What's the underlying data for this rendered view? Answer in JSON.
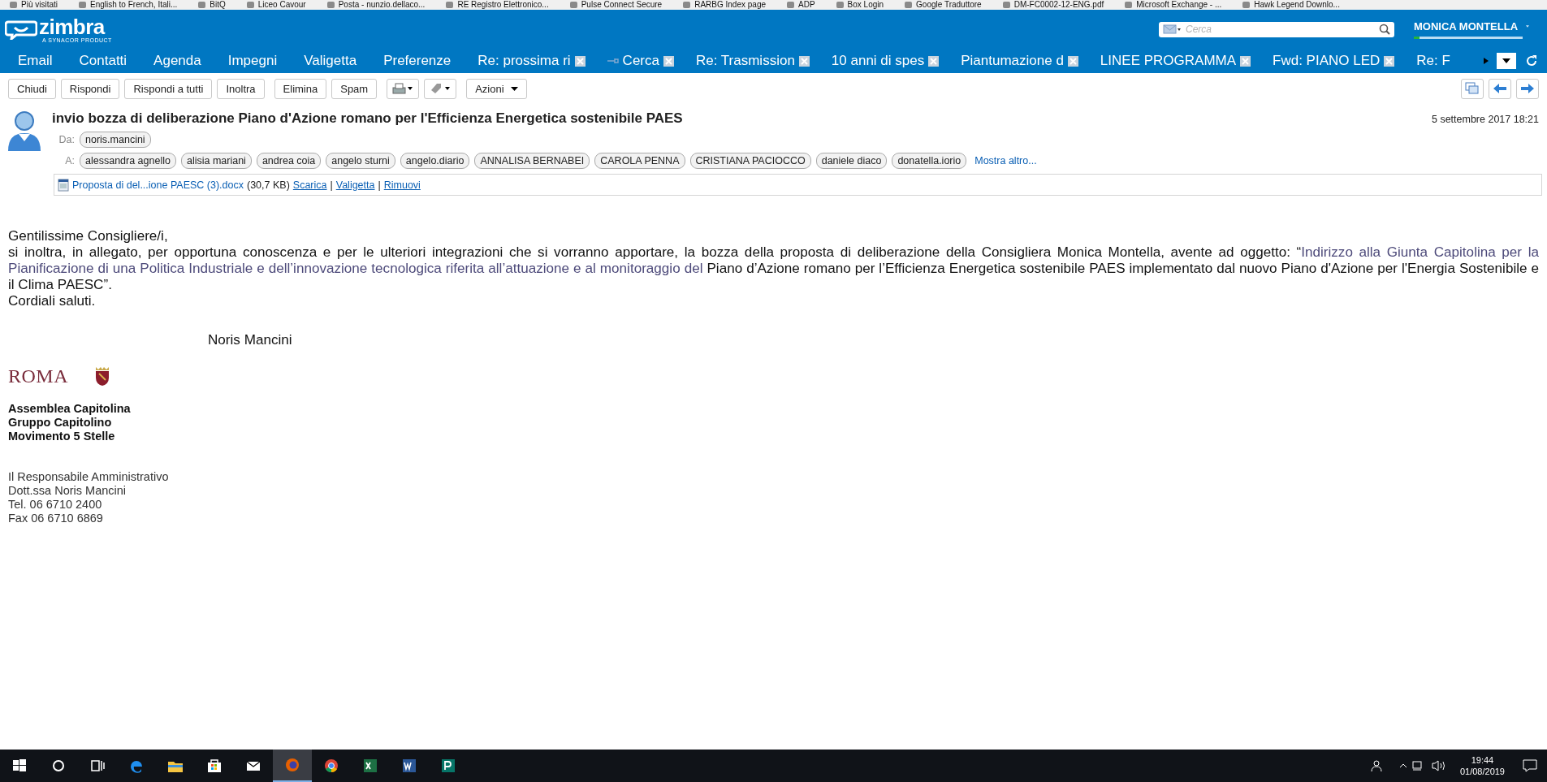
{
  "bookmarks": [
    {
      "label": "Più visitati"
    },
    {
      "label": "English to French, Itali..."
    },
    {
      "label": "BitQ"
    },
    {
      "label": "Liceo Cavour"
    },
    {
      "label": "Posta - nunzio.dellaco..."
    },
    {
      "label": "RE Registro Elettronico..."
    },
    {
      "label": "Pulse Connect Secure"
    },
    {
      "label": "RARBG Index page"
    },
    {
      "label": "ADP"
    },
    {
      "label": "Box Login"
    },
    {
      "label": "Google Traduttore"
    },
    {
      "label": "DM-FC0002-12-ENG.pdf"
    },
    {
      "label": "Microsoft Exchange - ..."
    },
    {
      "label": "Hawk Legend Downlo..."
    }
  ],
  "header": {
    "logo": "zimbra",
    "logo_tagline": "A SYNACOR PRODUCT",
    "search": {
      "placeholder": "Cerca"
    },
    "user": "MONICA MONTELLA",
    "quota": {
      "level": 0.05
    }
  },
  "app_tabs": [
    {
      "label": "Email"
    },
    {
      "label": "Contatti"
    },
    {
      "label": "Agenda"
    },
    {
      "label": "Impegni"
    },
    {
      "label": "Valigetta"
    },
    {
      "label": "Preferenze"
    }
  ],
  "open_tabs": [
    {
      "label": "Re: prossima ri",
      "kind": "mail"
    },
    {
      "label": "Cerca",
      "kind": "search"
    },
    {
      "label": "Re: Trasmission",
      "kind": "mail"
    },
    {
      "label": "10 anni di spes",
      "kind": "mail"
    },
    {
      "label": "Piantumazione d",
      "kind": "mail"
    },
    {
      "label": "LINEE PROGRAMMA",
      "kind": "mail"
    },
    {
      "label": "Fwd: PIANO LED",
      "kind": "mail"
    },
    {
      "label": "Re: F",
      "kind": "cut"
    }
  ],
  "toolbar": [
    {
      "label": "Chiudi",
      "kind": "text"
    },
    {
      "label": "Rispondi",
      "kind": "text"
    },
    {
      "label": "Rispondi a tutti",
      "kind": "text"
    },
    {
      "label": "Inoltra",
      "kind": "text"
    },
    {
      "label": "Elimina",
      "kind": "text"
    },
    {
      "label": "Spam",
      "kind": "text"
    },
    {
      "kind": "print"
    },
    {
      "kind": "tag"
    },
    {
      "label": "Azioni",
      "kind": "menu"
    }
  ],
  "message": {
    "subject": "invio bozza di deliberazione Piano d'Azione romano per l'Efficienza Energetica sostenibile PAES",
    "date": "5 settembre 2017 18:21",
    "from_label": "Da:",
    "from": "noris.mancini",
    "to_label": "A:",
    "to": [
      "alessandra agnello",
      "alisia mariani",
      "andrea coia",
      "angelo sturni",
      "angelo.diario",
      "ANNALISA BERNABEI",
      "CAROLA PENNA",
      "CRISTIANA PACIOCCO",
      "daniele diaco",
      "donatella.iorio"
    ],
    "more": "Mostra altro...",
    "attachment": {
      "name": "Proposta di del...ione PAESC (3).docx",
      "size": "(30,7 KB)",
      "actions": [
        "Scarica",
        "Valigetta",
        "Rimuovi"
      ],
      "separator": "|"
    }
  },
  "body": {
    "greeting": "Gentilissime Consigliere/i,",
    "paragraph": [
      {
        "text": "si inoltra, in allegato, per opportuna conoscenza e per le ulteriori integrazioni  che si vorranno apportare, la bozza della  proposta di deliberazione della Consigliera Monica Montella, avente ad oggetto: “",
        "accent": false
      },
      {
        "text": "Indirizzo alla Giunta Capitolina per la Pianificazione di una Politica Industriale e dell’innovazione tecnologica riferita all’attuazione e al monitoraggio del",
        "accent": true
      },
      {
        "text": " Piano d’Azione romano per l’Efficienza Energetica sostenibile PAES implementato dal nuovo Piano d'Azione per l'Energia Sostenibile e il Clima PAESC”.",
        "accent": false
      }
    ],
    "closing": "Cordiali saluti.",
    "signer": "Noris  Mancini",
    "logo": "ROMA",
    "org": [
      "Assemblea Capitolina",
      "Gruppo Capitolino",
      "Movimento 5 Stelle"
    ],
    "contact": [
      "Il Responsabile Amministrativo",
      "Dott.ssa Noris Mancini",
      "Tel. 06 6710 2400",
      "Fax 06 6710 6869"
    ]
  },
  "taskbar": {
    "apps": [
      {
        "kind": "start",
        "selected": false
      },
      {
        "kind": "search",
        "selected": false
      },
      {
        "kind": "taskview",
        "selected": false
      },
      {
        "kind": "edge",
        "selected": false
      },
      {
        "kind": "folder",
        "selected": false
      },
      {
        "kind": "store",
        "selected": false
      },
      {
        "kind": "mail",
        "selected": false
      },
      {
        "kind": "firefox",
        "selected": true
      },
      {
        "kind": "chrome",
        "selected": false
      },
      {
        "kind": "excel",
        "selected": false
      },
      {
        "kind": "word",
        "selected": false
      },
      {
        "kind": "publisher",
        "selected": false
      }
    ],
    "time": "19:44",
    "date": "01/08/2019"
  }
}
